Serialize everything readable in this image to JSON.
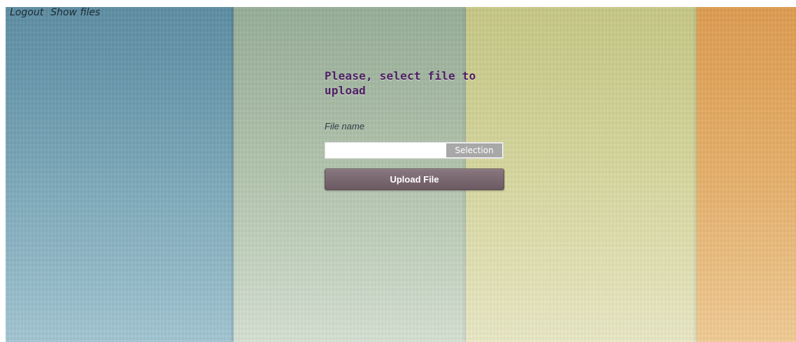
{
  "nav": {
    "logout": "Logout",
    "separator": "|",
    "show_files": "Show files"
  },
  "upload": {
    "title": "Please, select file to upload",
    "file_label": "File name",
    "file_value": "",
    "select_button": "Selection",
    "upload_button": "Upload File"
  },
  "colors": {
    "title": "#4d1f63",
    "upload_button": "#6b5a62",
    "select_button": "#a8a8a8",
    "stripe_blue": "#78a5b7",
    "stripe_green": "#b3c5ae",
    "stripe_yellow": "#d7d89f",
    "stripe_orange": "#e6b06b"
  }
}
